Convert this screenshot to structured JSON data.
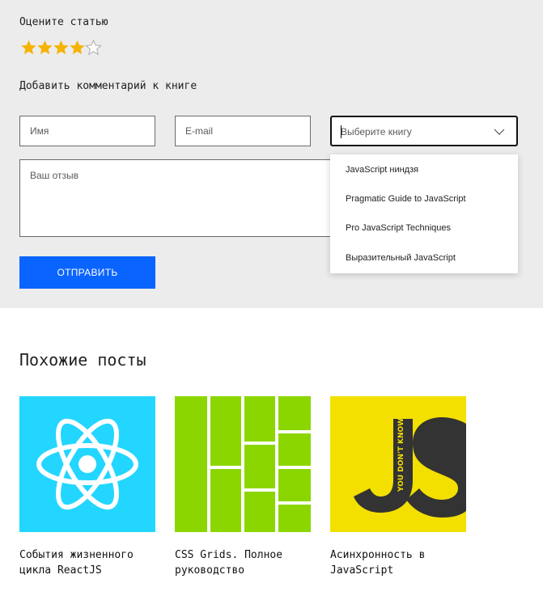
{
  "rating": {
    "title": "Оцените статью",
    "value": 4,
    "max": 5,
    "filled_color": "#f5b301",
    "empty_color": "#b0b0b0"
  },
  "comment": {
    "title": "Добавить комментарий к книге",
    "name_placeholder": "Имя",
    "email_placeholder": "E-mail",
    "review_placeholder": "Ваш отзыв",
    "book_select_placeholder": "Выберите книгу",
    "book_options": [
      "JavaScript ниндзя",
      "Pragmatic Guide to JavaScript",
      "Pro JavaScript Techniques",
      "Выразительный JavaScript"
    ],
    "submit_label": "ОТПРАВИТЬ",
    "accent_color": "#0a64ff"
  },
  "similar": {
    "title": "Похожие посты",
    "posts": [
      {
        "title": "События жизненного цикла ReactJS",
        "image": "react-logo"
      },
      {
        "title": "CSS Grids. Полное руководство",
        "image": "css-grid-pattern"
      },
      {
        "title": "Асинхронность в JavaScript",
        "image": "js-book-cover",
        "image_text": "YOU DON'T KNOW JS"
      }
    ]
  }
}
